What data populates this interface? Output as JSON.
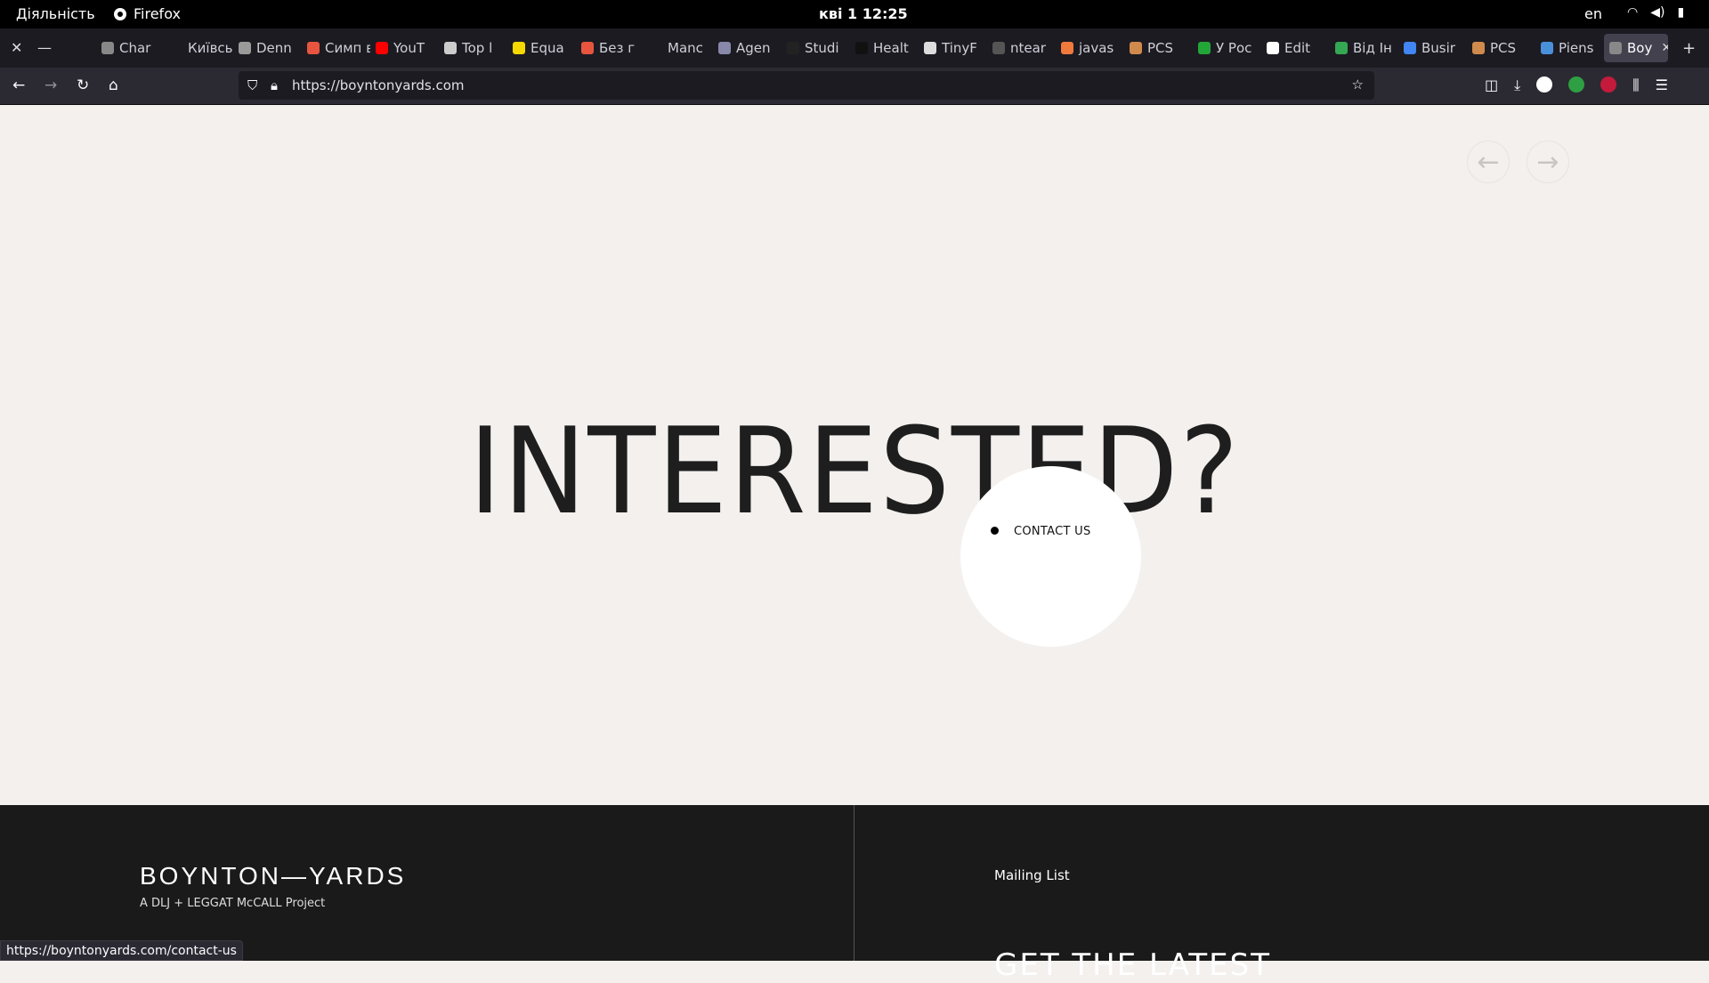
{
  "system_bar": {
    "activities": "Діяльність",
    "app_name": "Firefox",
    "clock": "кві 1  12:25",
    "lang": "en"
  },
  "tabs": [
    {
      "label": "Char",
      "color": "#888"
    },
    {
      "label": "Київські",
      "color": "#1c1b22"
    },
    {
      "label": "Denn",
      "color": "#9a9a9a"
    },
    {
      "label": "Симп відтв",
      "color": "#e8553f"
    },
    {
      "label": "YouT",
      "color": "#ff0000"
    },
    {
      "label": "Top l",
      "color": "#cccccc"
    },
    {
      "label": "Equa",
      "color": "#f5d800"
    },
    {
      "label": "Без г",
      "color": "#e8553f"
    },
    {
      "label": "Manc",
      "color": "#1c1b22"
    },
    {
      "label": "Agen",
      "color": "#8888aa"
    },
    {
      "label": "Studi",
      "color": "#222222"
    },
    {
      "label": "Healt",
      "color": "#111111"
    },
    {
      "label": "TinyF",
      "color": "#dddddd"
    },
    {
      "label": "ntear",
      "color": "#555555"
    },
    {
      "label": "javas",
      "color": "#f07a3c"
    },
    {
      "label": "PCS",
      "color": "#d08a4c"
    },
    {
      "label": "У Рос",
      "color": "#23a638"
    },
    {
      "label": "Edit",
      "color": "#ffffff"
    },
    {
      "label": "Від Ін",
      "color": "#34a853"
    },
    {
      "label": "Busir",
      "color": "#4285f4"
    },
    {
      "label": "PCS",
      "color": "#d08a4c"
    },
    {
      "label": "Piens",
      "color": "#4a90d9"
    },
    {
      "label": "Boy",
      "color": "#888888",
      "active": true
    }
  ],
  "navbar": {
    "url": "https://boyntonyards.com"
  },
  "page": {
    "headline": "INTERESTED?",
    "cta": "CONTACT US",
    "prev_arrow": "←",
    "next_arrow": "→"
  },
  "footer": {
    "logo": "BOYNTON—YARDS",
    "tagline": "A DLJ + LEGGAT McCALL Project",
    "mailing_list": "Mailing List",
    "latest": "GET THE LATEST"
  },
  "status_url": "https://boyntonyards.com/contact-us"
}
